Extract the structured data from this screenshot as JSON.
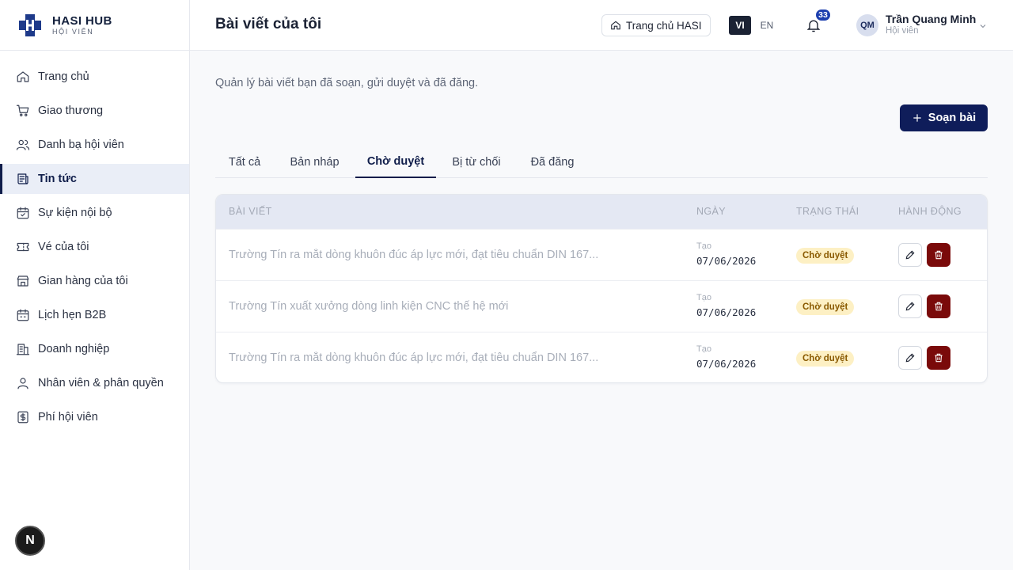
{
  "brand": {
    "name": "HASI HUB",
    "sub": "HỘI VIÊN"
  },
  "sidebar": {
    "items": [
      {
        "label": "Trang chủ",
        "icon": "home-icon"
      },
      {
        "label": "Giao thương",
        "icon": "cart-icon"
      },
      {
        "label": "Danh bạ hội viên",
        "icon": "users-icon"
      },
      {
        "label": "Tin tức",
        "icon": "newspaper-icon",
        "active": true
      },
      {
        "label": "Sự kiện nội bộ",
        "icon": "calendar-check-icon"
      },
      {
        "label": "Vé của tôi",
        "icon": "ticket-icon"
      },
      {
        "label": "Gian hàng của tôi",
        "icon": "store-icon"
      },
      {
        "label": "Lịch hẹn B2B",
        "icon": "calendar-icon"
      },
      {
        "label": "Doanh nghiệp",
        "icon": "building-icon"
      },
      {
        "label": "Nhân viên & phân quyền",
        "icon": "user-icon"
      },
      {
        "label": "Phí hội viên",
        "icon": "dollar-icon"
      }
    ],
    "badge": "N"
  },
  "header": {
    "title": "Bài viết của tôi",
    "home_label": "Trang chủ HASI",
    "lang_vi": "VI",
    "lang_en": "EN",
    "notif_count": "33",
    "user_initials": "QM",
    "user_name": "Trần Quang Minh",
    "user_role": "Hội viên"
  },
  "main": {
    "subtitle": "Quản lý bài viết bạn đã soạn, gửi duyệt và đã đăng.",
    "compose_label": "Soạn bài",
    "tabs": [
      {
        "label": "Tất cả"
      },
      {
        "label": "Bản nháp"
      },
      {
        "label": "Chờ duyệt",
        "active": true
      },
      {
        "label": "Bị từ chối"
      },
      {
        "label": "Đã đăng"
      }
    ],
    "table": {
      "headers": [
        "BÀI VIẾT",
        "NGÀY",
        "TRẠNG THÁI",
        "HÀNH ĐỘNG"
      ],
      "rows": [
        {
          "title": "Trường Tín ra mắt dòng khuôn đúc áp lực mới, đạt tiêu chuẩn DIN 167...",
          "date_label": "Tạo",
          "date": "07/06/2026",
          "status": "Chờ duyệt"
        },
        {
          "title": "Trường Tín xuất xưởng dòng linh kiện CNC thế hệ mới",
          "date_label": "Tạo",
          "date": "07/06/2026",
          "status": "Chờ duyệt"
        },
        {
          "title": "Trường Tín ra mắt dòng khuôn đúc áp lực mới, đạt tiêu chuẩn DIN 167...",
          "date_label": "Tạo",
          "date": "07/06/2026",
          "status": "Chờ duyệt"
        }
      ]
    }
  },
  "colors": {
    "accent": "#0f1d5a",
    "status_bg": "#fdf0c4",
    "danger": "#7a0a0a"
  }
}
